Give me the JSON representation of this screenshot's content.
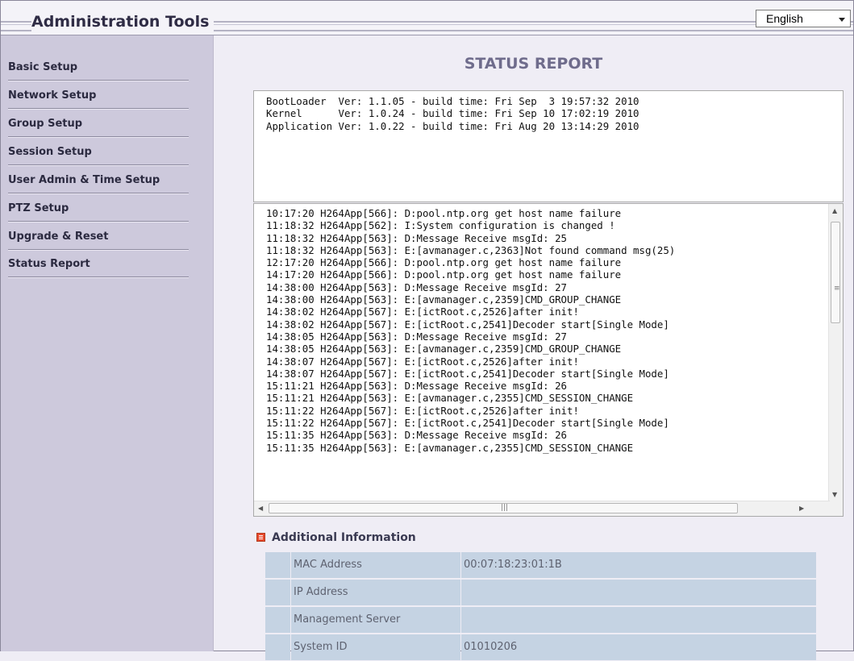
{
  "header": {
    "title": "Administration Tools",
    "language": "English"
  },
  "sidebar": {
    "items": [
      {
        "label": "Basic Setup"
      },
      {
        "label": "Network Setup"
      },
      {
        "label": "Group Setup"
      },
      {
        "label": "Session Setup"
      },
      {
        "label": "User Admin & Time Setup"
      },
      {
        "label": "PTZ Setup"
      },
      {
        "label": "Upgrade & Reset"
      },
      {
        "label": "Status Report"
      }
    ]
  },
  "main": {
    "title": "STATUS REPORT",
    "versions": [
      "BootLoader  Ver: 1.1.05 - build time: Fri Sep  3 19:57:32 2010",
      "Kernel      Ver: 1.0.24 - build time: Fri Sep 10 17:02:19 2010",
      "Application Ver: 1.0.22 - build time: Fri Aug 20 13:14:29 2010"
    ],
    "log": [
      "10:17:20 H264App[566]: D:pool.ntp.org get host name failure",
      "11:18:32 H264App[562]: I:System configuration is changed !",
      "11:18:32 H264App[563]: D:Message Receive msgId: 25",
      "11:18:32 H264App[563]: E:[avmanager.c,2363]Not found command msg(25)",
      "12:17:20 H264App[566]: D:pool.ntp.org get host name failure",
      "14:17:20 H264App[566]: D:pool.ntp.org get host name failure",
      "14:38:00 H264App[563]: D:Message Receive msgId: 27",
      "14:38:00 H264App[563]: E:[avmanager.c,2359]CMD_GROUP_CHANGE",
      "14:38:02 H264App[567]: E:[ictRoot.c,2526]after init!",
      "14:38:02 H264App[567]: E:[ictRoot.c,2541]Decoder start[Single Mode]",
      "14:38:05 H264App[563]: D:Message Receive msgId: 27",
      "14:38:05 H264App[563]: E:[avmanager.c,2359]CMD_GROUP_CHANGE",
      "14:38:07 H264App[567]: E:[ictRoot.c,2526]after init!",
      "14:38:07 H264App[567]: E:[ictRoot.c,2541]Decoder start[Single Mode]",
      "15:11:21 H264App[563]: D:Message Receive msgId: 26",
      "15:11:21 H264App[563]: E:[avmanager.c,2355]CMD_SESSION_CHANGE",
      "15:11:22 H264App[567]: E:[ictRoot.c,2526]after init!",
      "15:11:22 H264App[567]: E:[ictRoot.c,2541]Decoder start[Single Mode]",
      "15:11:35 H264App[563]: D:Message Receive msgId: 26",
      "15:11:35 H264App[563]: E:[avmanager.c,2355]CMD_SESSION_CHANGE"
    ],
    "additional_info": {
      "heading": "Additional Information",
      "rows": [
        {
          "label": "MAC Address",
          "value": "00:07:18:23:01:1B"
        },
        {
          "label": "IP Address",
          "value": ""
        },
        {
          "label": "Management Server",
          "value": ""
        },
        {
          "label": "System ID",
          "value": "01010206"
        }
      ]
    }
  },
  "icons": {
    "info_heading_icon": "list-icon",
    "select_arrow": "chevron-down-icon"
  }
}
